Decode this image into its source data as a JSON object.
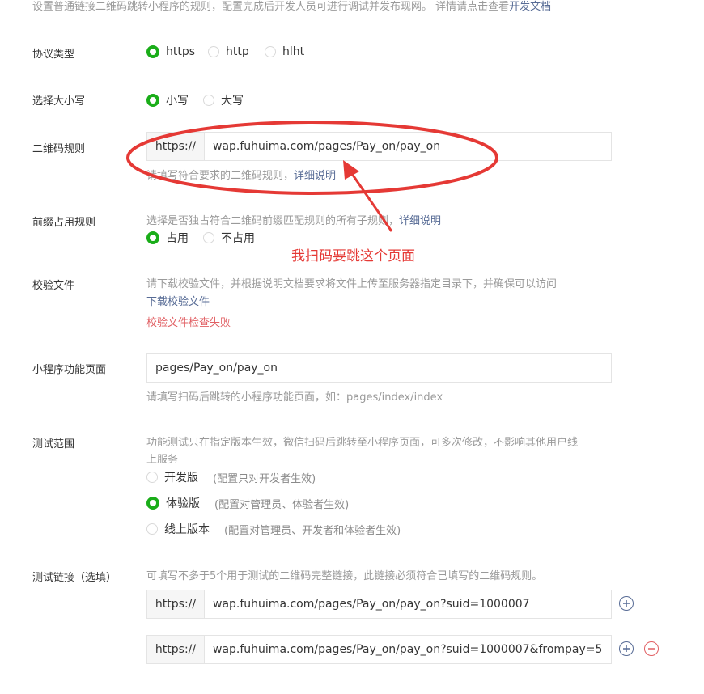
{
  "intro": {
    "text": "设置普通链接二维码跳转小程序的规则，配置完成后开发人员可进行调试并发布现网。 详情请点击查看",
    "link": "开发文档"
  },
  "protocol": {
    "label": "协议类型",
    "options": [
      {
        "label": "https",
        "selected": true
      },
      {
        "label": "http",
        "selected": false
      },
      {
        "label": "hlht",
        "selected": false
      }
    ]
  },
  "case": {
    "label": "选择大小写",
    "options": [
      {
        "label": "小写",
        "selected": true
      },
      {
        "label": "大写",
        "selected": false
      }
    ]
  },
  "qr_rule": {
    "label": "二维码规则",
    "prefix": "https://",
    "value": "wap.fuhuima.com/pages/Pay_on/pay_on",
    "tip": "请填写符合要求的二维码规则，",
    "tip_link": "详细说明"
  },
  "prefix_rule": {
    "label": "前缀占用规则",
    "tip": "选择是否独占符合二维码前缀匹配规则的所有子规则，",
    "tip_link": "详细说明",
    "options": [
      {
        "label": "占用",
        "selected": true
      },
      {
        "label": "不占用",
        "selected": false
      }
    ]
  },
  "annotation": {
    "text": "我扫码要跳这个页面",
    "color": "#e53935"
  },
  "verify_file": {
    "label": "校验文件",
    "tip": "请下载校验文件，并根据说明文档要求将文件上传至服务器指定目录下，并确保可以访问",
    "download_link": "下载校验文件",
    "error": "校验文件检查失败"
  },
  "mini_page": {
    "label": "小程序功能页面",
    "value": "pages/Pay_on/pay_on",
    "tip": "请填写扫码后跳转的小程序功能页面，如：pages/index/index"
  },
  "test_scope": {
    "label": "测试范围",
    "tip_line1": "功能测试只在指定版本生效，微信扫码后跳转至小程序页面，可多次修改，不影响其他用户线",
    "tip_line2": "上服务",
    "options": [
      {
        "label": "开发版",
        "note": "(配置只对开发者生效)",
        "selected": false
      },
      {
        "label": "体验版",
        "note": "(配置对管理员、体验者生效)",
        "selected": true
      },
      {
        "label": "线上版本",
        "note": "(配置对管理员、开发者和体验者生效)",
        "selected": false
      }
    ]
  },
  "test_links": {
    "label": "测试链接（选填）",
    "tip": "可填写不多于5个用于测试的二维码完整链接，此链接必须符合已填写的二维码规则。",
    "items": [
      {
        "prefix": "https://",
        "value": "wap.fuhuima.com/pages/Pay_on/pay_on?suid=1000007"
      },
      {
        "prefix": "https://",
        "value": "wap.fuhuima.com/pages/Pay_on/pay_on?suid=1000007&frompay=5"
      }
    ]
  },
  "colors": {
    "accent_green": "#1aad19",
    "link_blue": "#576b95",
    "error_red": "#e15f63"
  }
}
